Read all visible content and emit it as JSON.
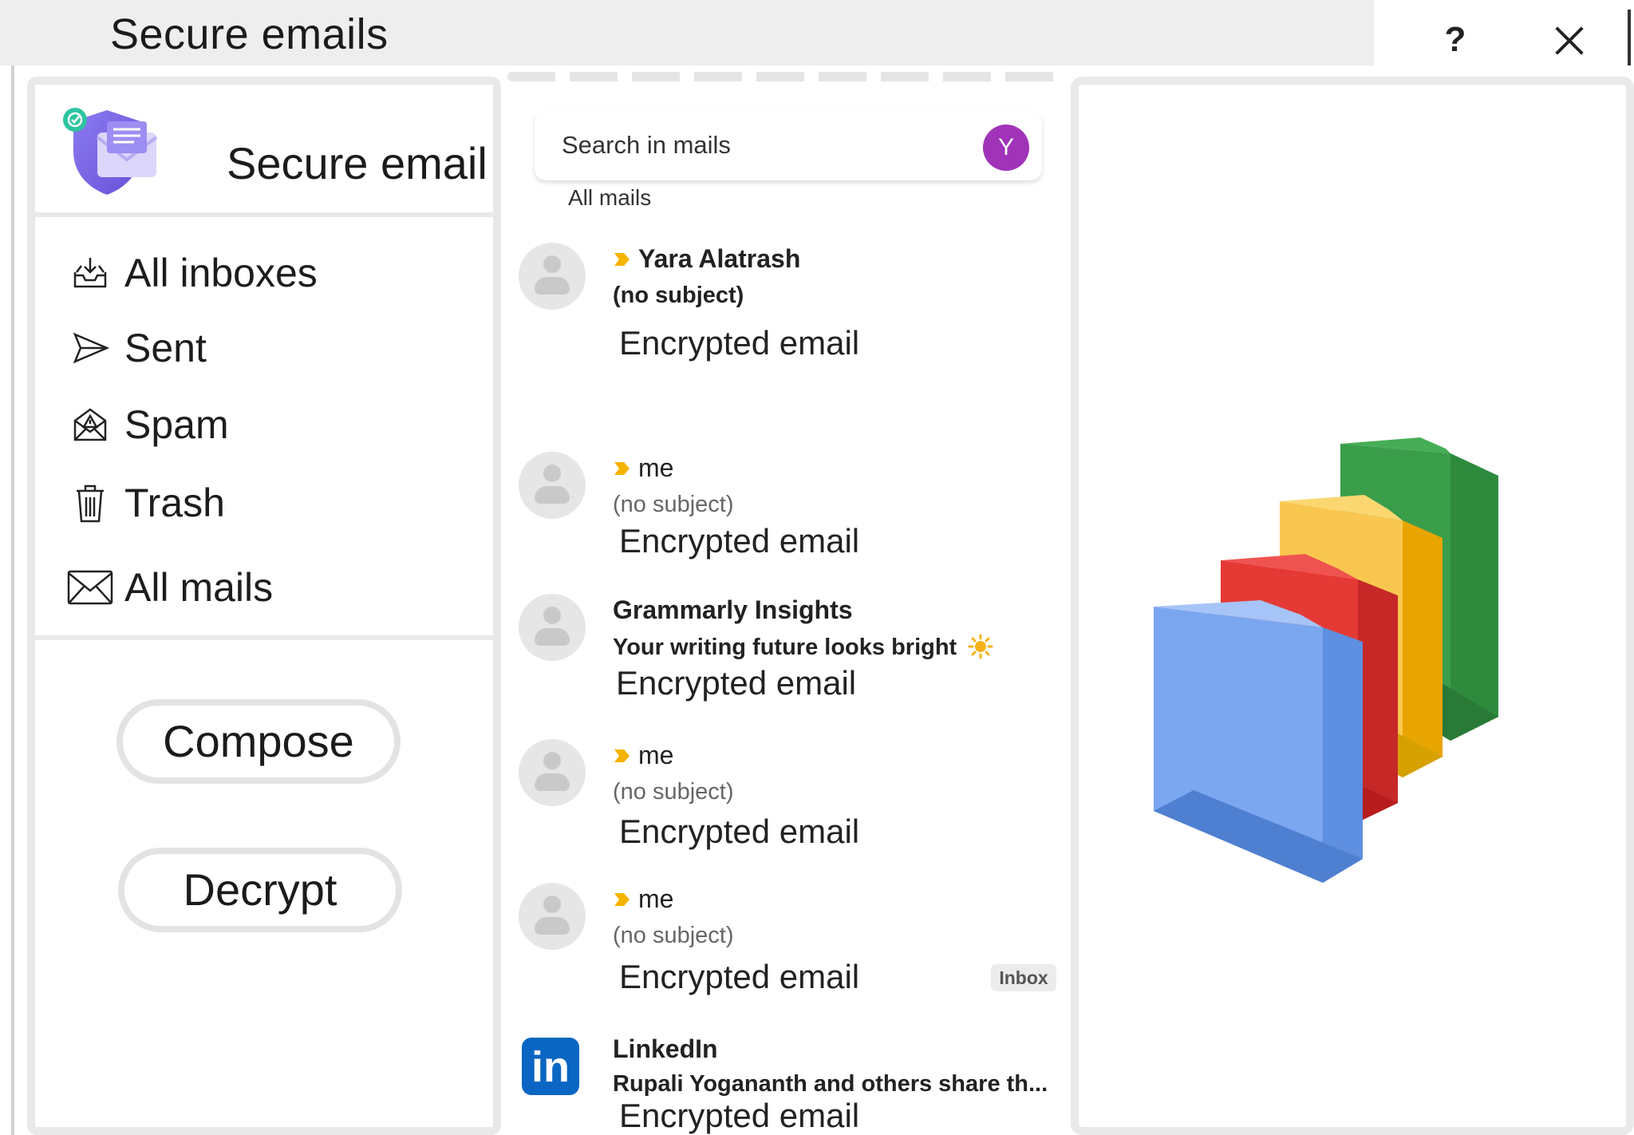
{
  "window": {
    "title": "Secure emails",
    "help_label": "?"
  },
  "sidebar": {
    "brand": "Secure email",
    "nav": [
      {
        "label": "All inboxes",
        "icon": "inbox-download-icon"
      },
      {
        "label": "Sent",
        "icon": "send-icon"
      },
      {
        "label": "Spam",
        "icon": "spam-icon"
      },
      {
        "label": "Trash",
        "icon": "trash-icon"
      },
      {
        "label": "All mails",
        "icon": "envelope-icon"
      }
    ],
    "compose_label": "Compose",
    "decrypt_label": "Decrypt"
  },
  "list": {
    "search_placeholder": "Search in mails",
    "account_initial": "Y",
    "heading": "All mails",
    "mails": [
      {
        "sender": "Yara Alatrash",
        "subject": "(no subject)",
        "preview": "Encrypted email",
        "important": true,
        "unread": true
      },
      {
        "sender": "me",
        "subject": "(no subject)",
        "preview": "Encrypted email",
        "important": true,
        "unread": false
      },
      {
        "sender": "Grammarly Insights",
        "subject": "Your writing future looks bright",
        "preview": "Encrypted email",
        "important": false,
        "unread": true
      },
      {
        "sender": "me",
        "subject": "(no subject)",
        "preview": "Encrypted email",
        "important": true,
        "unread": false
      },
      {
        "sender": "me",
        "subject": "(no subject)",
        "preview": "Encrypted email",
        "important": true,
        "unread": false,
        "badge": "Inbox"
      },
      {
        "sender": "LinkedIn",
        "subject": "Rupali Yogananth and others share th...",
        "preview": "Encrypted email",
        "important": false,
        "unread": true
      }
    ]
  },
  "colors": {
    "accent_purple": "#a033b8",
    "important_marker": "#f4b400",
    "linkedin_blue": "#0a66c2",
    "folder_green": "#34a853",
    "folder_yellow": "#fbbc04",
    "folder_red": "#ea4335",
    "folder_blue": "#7ba7f0"
  }
}
